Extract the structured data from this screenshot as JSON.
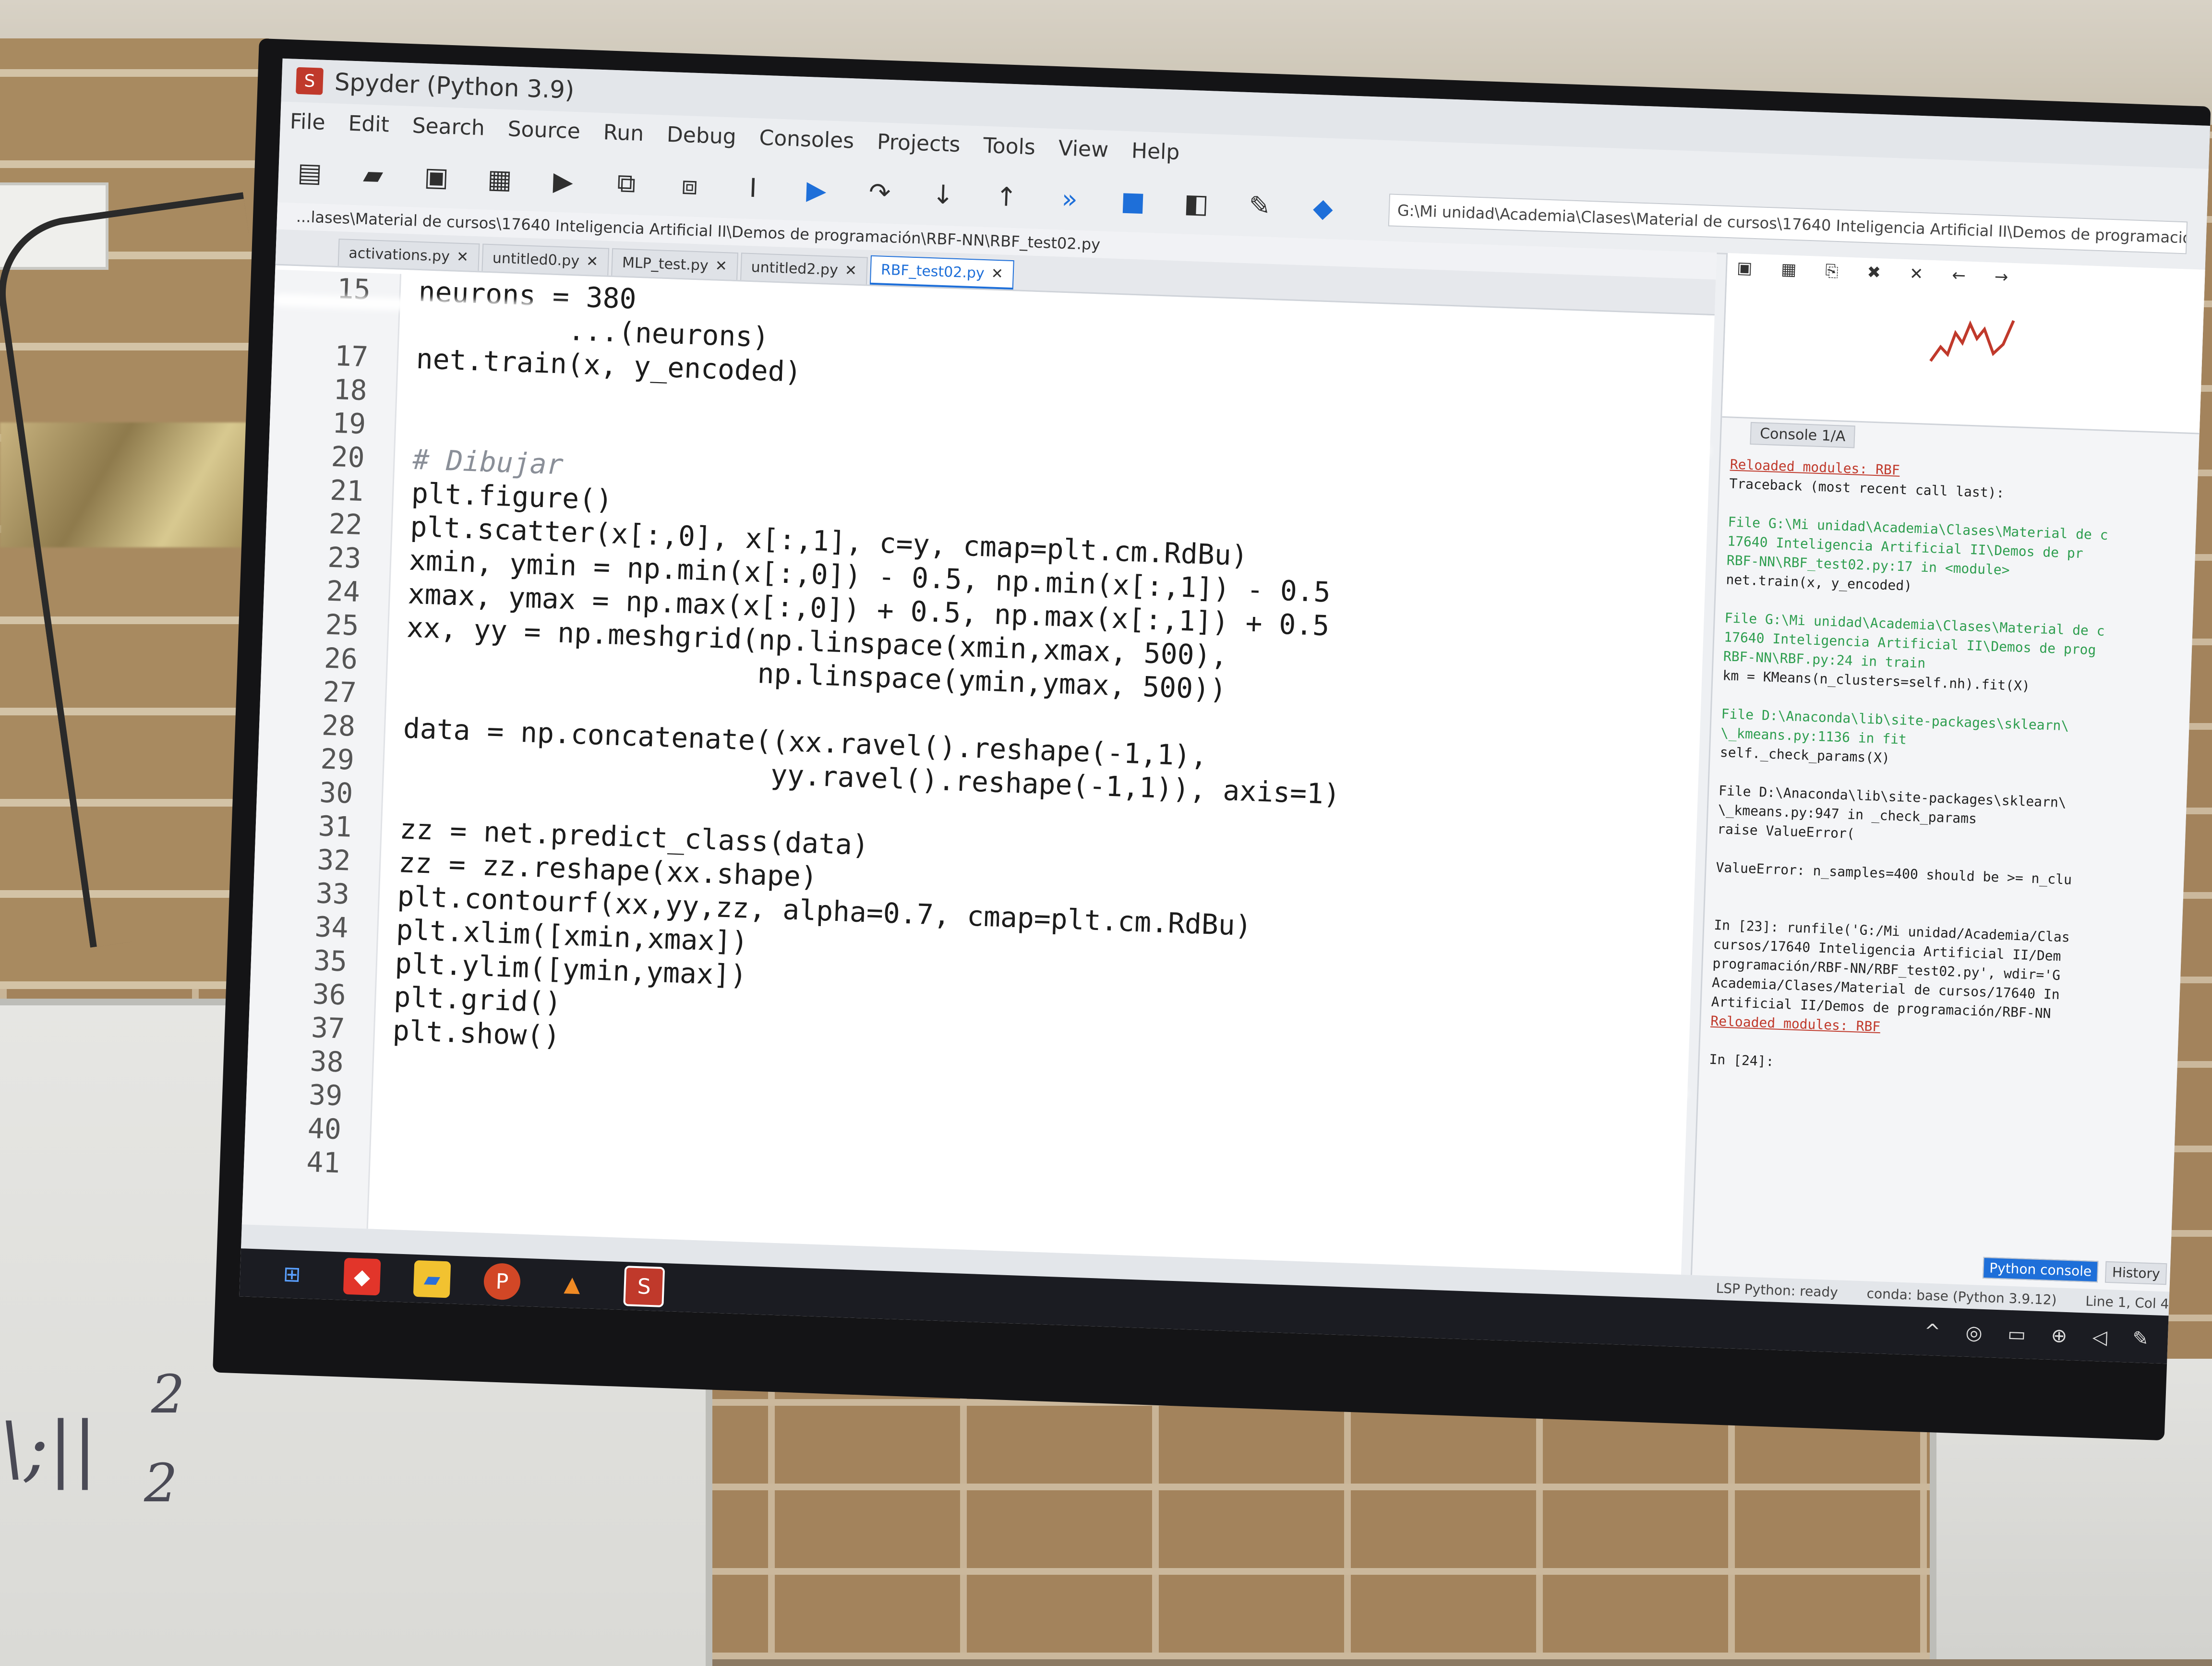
{
  "window": {
    "title": "Spyder (Python 3.9)"
  },
  "menu": [
    "File",
    "Edit",
    "Search",
    "Source",
    "Run",
    "Debug",
    "Consoles",
    "Projects",
    "Tools",
    "View",
    "Help"
  ],
  "toolbar": {
    "icons": [
      "new-file-icon",
      "open-folder-icon",
      "save-icon",
      "save-all-icon",
      "run-icon",
      "run-cell-icon",
      "run-cell-advance-icon",
      "run-selection-icon",
      "debug-icon",
      "step-icon",
      "step-into-icon",
      "step-return-icon",
      "continue-icon",
      "stop-icon",
      "maximize-pane-icon",
      "preferences-icon",
      "python-path-icon"
    ],
    "path": "G:\\Mi unidad\\Academia\\Clases\\Material de cursos\\17640 Inteligencia Artificial II\\Demos de programación\\RBF-NN"
  },
  "editor": {
    "filepath": "...lases\\Material de cursos\\17640 Inteligencia Artificial II\\Demos de programación\\RBF-NN\\RBF_test02.py",
    "tabs": [
      {
        "label": "activations.py",
        "active": false
      },
      {
        "label": "untitled0.py",
        "active": false
      },
      {
        "label": "MLP_test.py",
        "active": false
      },
      {
        "label": "untitled2.py",
        "active": false
      },
      {
        "label": "RBF_test02.py",
        "active": true
      }
    ],
    "lines": [
      {
        "n": "15",
        "text": "neurons = 380"
      },
      {
        "n": "",
        "text": "         ...(neurons)"
      },
      {
        "n": "17",
        "text": "net.train(x, y_encoded)"
      },
      {
        "n": "18",
        "text": ""
      },
      {
        "n": "19",
        "text": ""
      },
      {
        "n": "20",
        "text": "# Dibujar",
        "comment": true
      },
      {
        "n": "21",
        "text": "plt.figure()"
      },
      {
        "n": "22",
        "text": "plt.scatter(x[:,0], x[:,1], c=y, cmap=plt.cm.RdBu)"
      },
      {
        "n": "23",
        "text": "xmin, ymin = np.min(x[:,0]) - 0.5, np.min(x[:,1]) - 0.5"
      },
      {
        "n": "24",
        "text": "xmax, ymax = np.max(x[:,0]) + 0.5, np.max(x[:,1]) + 0.5"
      },
      {
        "n": "25",
        "text": "xx, yy = np.meshgrid(np.linspace(xmin,xmax, 500),"
      },
      {
        "n": "26",
        "text": "                     np.linspace(ymin,ymax, 500))"
      },
      {
        "n": "27",
        "text": ""
      },
      {
        "n": "28",
        "text": "data = np.concatenate((xx.ravel().reshape(-1,1),"
      },
      {
        "n": "29",
        "text": "                      yy.ravel().reshape(-1,1)), axis=1)"
      },
      {
        "n": "30",
        "text": ""
      },
      {
        "n": "31",
        "text": "zz = net.predict_class(data)"
      },
      {
        "n": "32",
        "text": "zz = zz.reshape(xx.shape)"
      },
      {
        "n": "33",
        "text": "plt.contourf(xx,yy,zz, alpha=0.7, cmap=plt.cm.RdBu)"
      },
      {
        "n": "34",
        "text": "plt.xlim([xmin,xmax])"
      },
      {
        "n": "35",
        "text": "plt.ylim([ymin,ymax])"
      },
      {
        "n": "36",
        "text": "plt.grid()"
      },
      {
        "n": "37",
        "text": "plt.show()"
      },
      {
        "n": "38",
        "text": ""
      },
      {
        "n": "39",
        "text": ""
      },
      {
        "n": "40",
        "text": ""
      },
      {
        "n": "41",
        "text": ""
      }
    ]
  },
  "console": {
    "tab": "Console 1/A",
    "lines": [
      {
        "text": "Reloaded modules: RBF",
        "style": "red"
      },
      {
        "text": "Traceback (most recent call last):",
        "style": ""
      },
      {
        "text": "",
        "style": "gap"
      },
      {
        "text": "  File G:\\Mi unidad\\Academia\\Clases\\Material de c",
        "style": "green"
      },
      {
        "text": "  17640 Inteligencia Artificial II\\Demos de pr",
        "style": "green"
      },
      {
        "text": "  RBF-NN\\RBF_test02.py:17 in <module>",
        "style": "green"
      },
      {
        "text": "    net.train(x, y_encoded)",
        "style": ""
      },
      {
        "text": "",
        "style": "gap"
      },
      {
        "text": "  File G:\\Mi unidad\\Academia\\Clases\\Material de c",
        "style": "green"
      },
      {
        "text": "  17640 Inteligencia Artificial II\\Demos de prog",
        "style": "green"
      },
      {
        "text": "  RBF-NN\\RBF.py:24 in train",
        "style": "green"
      },
      {
        "text": "    km = KMeans(n_clusters=self.nh).fit(X)",
        "style": ""
      },
      {
        "text": "",
        "style": "gap"
      },
      {
        "text": "  File D:\\Anaconda\\lib\\site-packages\\sklearn\\",
        "style": "green"
      },
      {
        "text": "  \\_kmeans.py:1136 in fit",
        "style": "green"
      },
      {
        "text": "    self._check_params(X)",
        "style": ""
      },
      {
        "text": "",
        "style": "gap"
      },
      {
        "text": "  File D:\\Anaconda\\lib\\site-packages\\sklearn\\",
        "style": ""
      },
      {
        "text": "  \\_kmeans.py:947 in _check_params",
        "style": ""
      },
      {
        "text": "    raise ValueError(",
        "style": ""
      },
      {
        "text": "",
        "style": "gap"
      },
      {
        "text": "ValueError: n_samples=400 should be >= n_clu",
        "style": ""
      },
      {
        "text": "",
        "style": "gap"
      },
      {
        "text": "",
        "style": "gap"
      },
      {
        "text": "In [23]: runfile('G:/Mi unidad/Academia/Clas",
        "style": ""
      },
      {
        "text": "cursos/17640 Inteligencia Artificial II/Dem",
        "style": ""
      },
      {
        "text": "programación/RBF-NN/RBF_test02.py', wdir='G",
        "style": ""
      },
      {
        "text": "Academia/Clases/Material de cursos/17640 In",
        "style": ""
      },
      {
        "text": "Artificial II/Demos de programación/RBF-NN",
        "style": ""
      },
      {
        "text": "Reloaded modules: RBF",
        "style": "red"
      },
      {
        "text": "",
        "style": "gap"
      },
      {
        "text": "In [24]:",
        "style": ""
      }
    ],
    "bottom_tabs": [
      "Python console",
      "History"
    ]
  },
  "statusbar": {
    "lsp": "LSP Python: ready",
    "env": "conda: base (Python 3.9.12)",
    "position": "Line 1, Col 4"
  },
  "taskbar": {
    "icons": [
      "windows-start-icon",
      "red-app-icon",
      "file-explorer-icon",
      "powerpoint-icon",
      "matlab-icon",
      "spyder-icon"
    ]
  },
  "board": {
    "scribble_main": "\\;||",
    "scribble_sup": "2",
    "scribble_sub": "2"
  }
}
